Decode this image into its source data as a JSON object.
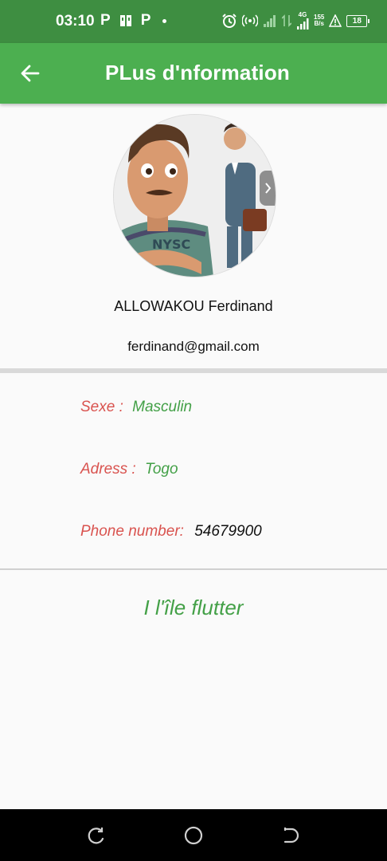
{
  "status_bar": {
    "time": "03:10",
    "left_icons": [
      "p-notification-icon",
      "pp-icon",
      "p-notification-icon",
      "dot-icon"
    ],
    "network_speed_value": "155",
    "network_speed_unit": "B/s",
    "network_type": "4G",
    "battery_level": "18"
  },
  "app_bar": {
    "title": "PLus d'nformation",
    "back_icon": "arrow-left-icon",
    "color": "#4caf50"
  },
  "profile": {
    "name": "ALLOWAKOU Ferdinand",
    "email": "ferdinand@gmail.com"
  },
  "info": {
    "sexe_label": "Sexe :",
    "sexe_value": "Masculin",
    "adress_label": "Adress :",
    "adress_value": "Togo",
    "phone_label": "Phone number:",
    "phone_value": "54679900"
  },
  "footer": {
    "text": "I l'île flutter"
  },
  "colors": {
    "status_bar": "#3e8e41",
    "label_red": "#d9534f",
    "value_green": "#43a047"
  },
  "nav_bar": {
    "icons": [
      "recents-icon",
      "home-icon",
      "back-icon"
    ]
  }
}
